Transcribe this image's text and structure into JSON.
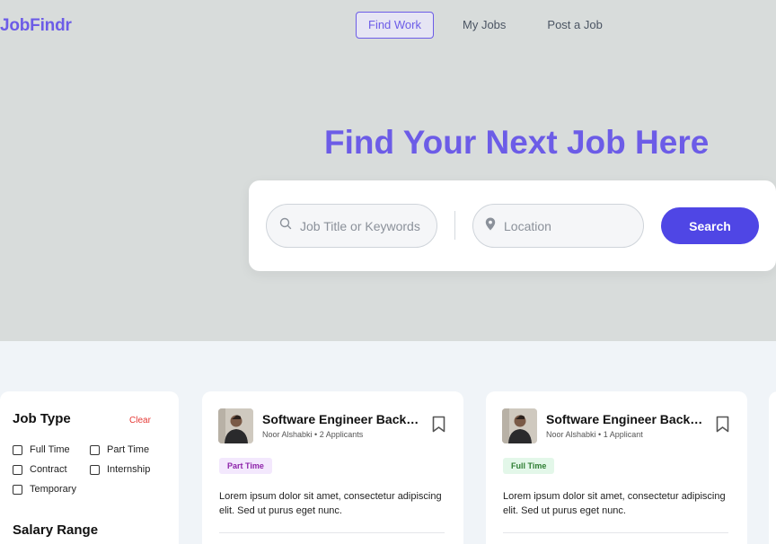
{
  "app": {
    "logo": "JobFindr"
  },
  "nav": {
    "items": [
      {
        "label": "Find Work",
        "active": true
      },
      {
        "label": "My Jobs",
        "active": false
      },
      {
        "label": "Post a Job",
        "active": false
      }
    ]
  },
  "hero": {
    "title": "Find Your Next Job Here",
    "keywords_placeholder": "Job Title or Keywords",
    "location_placeholder": "Location",
    "search_label": "Search"
  },
  "filters": {
    "job_type_title": "Job Type",
    "clear_label": "Clear",
    "options": [
      "Full Time",
      "Part Time",
      "Contract",
      "Internship",
      "Temporary"
    ],
    "salary_title": "Salary Range"
  },
  "jobs": [
    {
      "title": "Software Engineer Back-End Developer",
      "author": "Noor Alshabki",
      "applicants": "2 Applicants",
      "type": "Part Time",
      "description": "Lorem ipsum dolor sit amet, consectetur adipiscing elit. Sed ut purus eget nunc."
    },
    {
      "title": "Software Engineer Back-End Developer",
      "author": "Noor Alshabki",
      "applicants": "1 Applicant",
      "type": "Full Time",
      "description": "Lorem ipsum dolor sit amet, consectetur adipiscing elit. Sed ut purus eget nunc."
    }
  ],
  "colors": {
    "brand": "#6c5ce7",
    "search_button": "#4f46e5",
    "clear": "#e53935"
  },
  "icons": {
    "search": "search-icon",
    "location": "map-pin-icon",
    "bookmark": "bookmark-icon"
  }
}
